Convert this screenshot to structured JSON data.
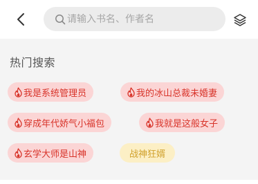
{
  "header": {
    "back_icon": "chevron-left-icon",
    "search_icon": "search-icon",
    "menu_icon": "layers-icon"
  },
  "search": {
    "placeholder": "请输入书名、作者名",
    "value": ""
  },
  "hot_search": {
    "title": "热门搜索",
    "tags": [
      {
        "label": "我是系统管理员",
        "hot": true
      },
      {
        "label": "我的冰山总裁未婚妻",
        "hot": true
      },
      {
        "label": "穿成年代娇气小福包",
        "hot": true
      },
      {
        "label": "我就是这般女子",
        "hot": true
      },
      {
        "label": "玄学大师是山神",
        "hot": true
      },
      {
        "label": "战神狂婿",
        "hot": false
      }
    ]
  },
  "colors": {
    "hot_tag_bg": "#fbd5d5",
    "hot_tag_text": "#d8342a",
    "plain_tag_bg": "#fcefc5",
    "plain_tag_text": "#d1a22e",
    "page_bg": "#f4f4f4"
  }
}
